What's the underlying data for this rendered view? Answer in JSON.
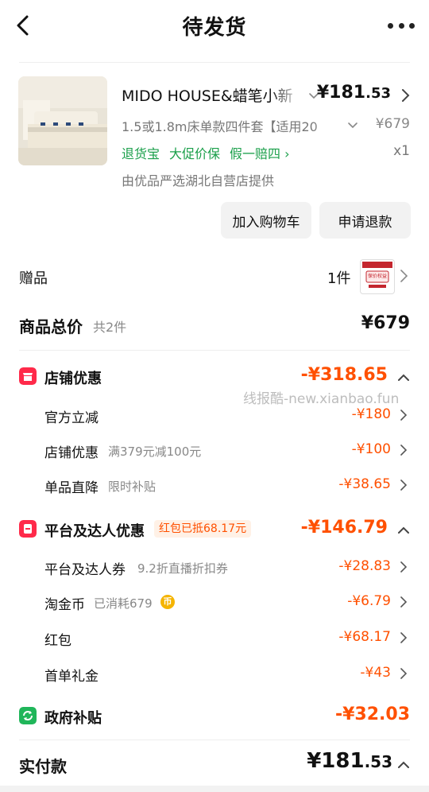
{
  "header": {
    "title": "待发货"
  },
  "product": {
    "name": "MIDO HOUSE&蜡笔小新",
    "price_main": "¥181",
    "price_decimal": ".53",
    "spec": "1.5或1.8m床单款四件套【适用20",
    "original_price": "¥679",
    "tags": [
      "退货宝",
      "大促价保",
      "假一赔四 ›"
    ],
    "quantity": "x1",
    "store": "由优品严选湖北自营店提供"
  },
  "actions": {
    "add_to_cart": "加入购物车",
    "refund": "申请退款"
  },
  "gift": {
    "label": "赠品",
    "quantity": "1件",
    "image_text": "保价权益"
  },
  "total": {
    "label": "商品总价",
    "count": "共2件",
    "value": "¥679"
  },
  "store_discount": {
    "label": "店铺优惠",
    "value": "-¥318.65",
    "items": [
      {
        "label": "官方立减",
        "sub": "",
        "value": "-¥180"
      },
      {
        "label": "店铺优惠",
        "sub": "满379元减100元",
        "value": "-¥100"
      },
      {
        "label": "单品直降",
        "sub": "限时补贴",
        "value": "-¥38.65"
      }
    ]
  },
  "platform_discount": {
    "label": "平台及达人优惠",
    "badge": "红包已抵68.17元",
    "value": "-¥146.79",
    "items": [
      {
        "label": "平台及达人券",
        "sub": "9.2折直播折扣券",
        "value": "-¥28.83"
      },
      {
        "label": "淘金币",
        "sub": "已消耗679",
        "value": "-¥6.79"
      },
      {
        "label": "红包",
        "sub": "",
        "value": "-¥68.17"
      },
      {
        "label": "首单礼金",
        "sub": "",
        "value": "-¥43"
      }
    ]
  },
  "gov_subsidy": {
    "label": "政府补贴",
    "value": "-¥32.03"
  },
  "payment": {
    "label": "实付款",
    "value_main": "¥181",
    "value_decimal": ".53"
  },
  "watermark": "线报酷-new.xianbao.fun",
  "colors": {
    "accent": "#ff5000",
    "green": "#1a9f4a",
    "store_icon": "#ff2a4a",
    "gov_icon": "#20b65a"
  }
}
